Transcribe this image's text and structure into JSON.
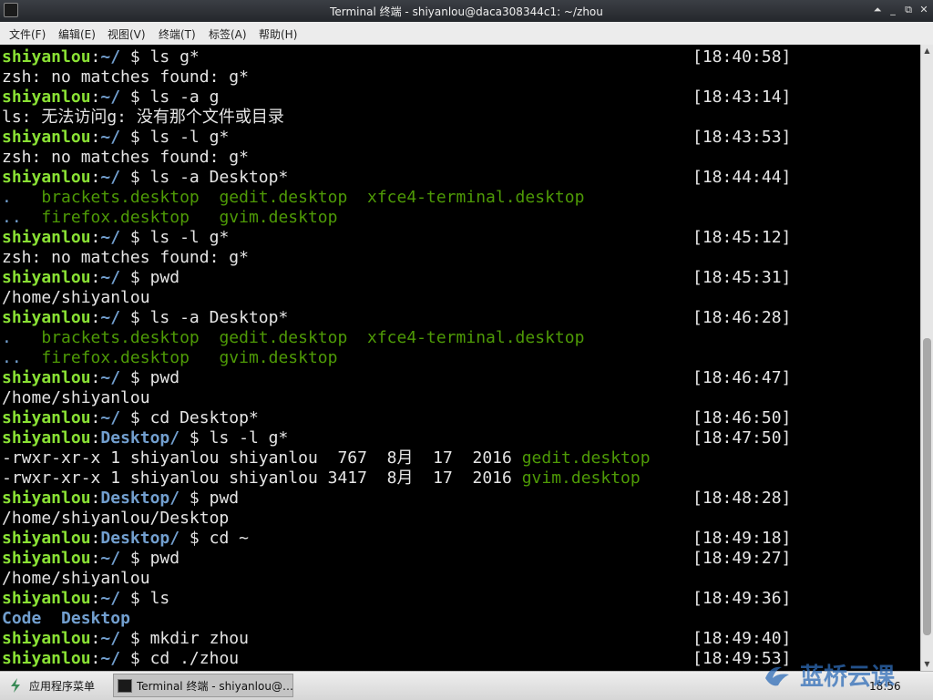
{
  "window": {
    "title": "Terminal 终端 - shiyanlou@daca308344c1: ~/zhou",
    "buttons": {
      "shade": "⏶",
      "minimize": "_",
      "maximize": "⧉",
      "close": "✕"
    }
  },
  "menubar": [
    "文件(F)",
    "编辑(E)",
    "视图(V)",
    "终端(T)",
    "标签(A)",
    "帮助(H)"
  ],
  "colors": {
    "user": "#8ae234",
    "path": "#729fcf",
    "executable": "#4e9a06",
    "text": "#e5e5e5",
    "background": "#000000"
  },
  "terminal": {
    "lines": [
      {
        "type": "prompt",
        "user": "shiyanlou",
        "dir": "~/",
        "command": "ls g*",
        "time": "[18:40:58]"
      },
      {
        "type": "output",
        "text": "zsh: no matches found: g*"
      },
      {
        "type": "prompt",
        "user": "shiyanlou",
        "dir": "~/",
        "command": "ls -a g",
        "time": "[18:43:14]"
      },
      {
        "type": "output",
        "text": "ls: 无法访问g: 没有那个文件或目录"
      },
      {
        "type": "prompt",
        "user": "shiyanlou",
        "dir": "~/",
        "command": "ls -l g*",
        "time": "[18:43:53]"
      },
      {
        "type": "output",
        "text": "zsh: no matches found: g*"
      },
      {
        "type": "prompt",
        "user": "shiyanlou",
        "dir": "~/",
        "command": "ls -a Desktop*",
        "time": "[18:44:44]"
      },
      {
        "type": "listing",
        "items": [
          {
            "name": ".",
            "kind": "dir"
          },
          {
            "name": "brackets.desktop",
            "kind": "exe"
          },
          {
            "name": "gedit.desktop",
            "kind": "exe"
          },
          {
            "name": "xfce4-terminal.desktop",
            "kind": "exe"
          }
        ]
      },
      {
        "type": "listing",
        "items": [
          {
            "name": "..",
            "kind": "dir"
          },
          {
            "name": "firefox.desktop",
            "kind": "exe"
          },
          {
            "name": "gvim.desktop",
            "kind": "exe"
          }
        ]
      },
      {
        "type": "prompt",
        "user": "shiyanlou",
        "dir": "~/",
        "command": "ls -l g*",
        "time": "[18:45:12]"
      },
      {
        "type": "output",
        "text": "zsh: no matches found: g*"
      },
      {
        "type": "prompt",
        "user": "shiyanlou",
        "dir": "~/",
        "command": "pwd",
        "time": "[18:45:31]"
      },
      {
        "type": "output",
        "text": "/home/shiyanlou"
      },
      {
        "type": "prompt",
        "user": "shiyanlou",
        "dir": "~/",
        "command": "ls -a Desktop*",
        "time": "[18:46:28]"
      },
      {
        "type": "listing",
        "items": [
          {
            "name": ".",
            "kind": "dir"
          },
          {
            "name": "brackets.desktop",
            "kind": "exe"
          },
          {
            "name": "gedit.desktop",
            "kind": "exe"
          },
          {
            "name": "xfce4-terminal.desktop",
            "kind": "exe"
          }
        ]
      },
      {
        "type": "listing",
        "items": [
          {
            "name": "..",
            "kind": "dir"
          },
          {
            "name": "firefox.desktop",
            "kind": "exe"
          },
          {
            "name": "gvim.desktop",
            "kind": "exe"
          }
        ]
      },
      {
        "type": "prompt",
        "user": "shiyanlou",
        "dir": "~/",
        "command": "pwd",
        "time": "[18:46:47]"
      },
      {
        "type": "output",
        "text": "/home/shiyanlou"
      },
      {
        "type": "prompt",
        "user": "shiyanlou",
        "dir": "~/",
        "command": "cd Desktop*",
        "time": "[18:46:50]"
      },
      {
        "type": "prompt",
        "user": "shiyanlou",
        "dir": "Desktop/",
        "command": "ls -l g*",
        "time": "[18:47:50]"
      },
      {
        "type": "longlisting",
        "perms": "-rwxr-xr-x",
        "links": "1",
        "owner": "shiyanlou",
        "group": "shiyanlou",
        "size": " 767",
        "date": "8月  17  2016",
        "name": "gedit.desktop"
      },
      {
        "type": "longlisting",
        "perms": "-rwxr-xr-x",
        "links": "1",
        "owner": "shiyanlou",
        "group": "shiyanlou",
        "size": "3417",
        "date": "8月  17  2016",
        "name": "gvim.desktop"
      },
      {
        "type": "prompt",
        "user": "shiyanlou",
        "dir": "Desktop/",
        "command": "pwd",
        "time": "[18:48:28]"
      },
      {
        "type": "output",
        "text": "/home/shiyanlou/Desktop"
      },
      {
        "type": "prompt",
        "user": "shiyanlou",
        "dir": "Desktop/",
        "command": "cd ~",
        "time": "[18:49:18]"
      },
      {
        "type": "prompt",
        "user": "shiyanlou",
        "dir": "~/",
        "command": "pwd",
        "time": "[18:49:27]"
      },
      {
        "type": "output",
        "text": "/home/shiyanlou"
      },
      {
        "type": "prompt",
        "user": "shiyanlou",
        "dir": "~/",
        "command": "ls",
        "time": "[18:49:36]"
      },
      {
        "type": "listing",
        "items": [
          {
            "name": "Code",
            "kind": "dirb"
          },
          {
            "name": "Desktop",
            "kind": "dirb"
          }
        ]
      },
      {
        "type": "prompt",
        "user": "shiyanlou",
        "dir": "~/",
        "command": "mkdir zhou",
        "time": "[18:49:40]"
      },
      {
        "type": "prompt",
        "user": "shiyanlou",
        "dir": "~/",
        "command": "cd ./zhou",
        "time": "[18:49:53]"
      }
    ]
  },
  "taskbar": {
    "app_menu_label": "应用程序菜单",
    "task_label": "Terminal 终端 - shiyanlou@…",
    "clock": "18:56"
  },
  "watermark": {
    "text": "蓝桥云课"
  }
}
